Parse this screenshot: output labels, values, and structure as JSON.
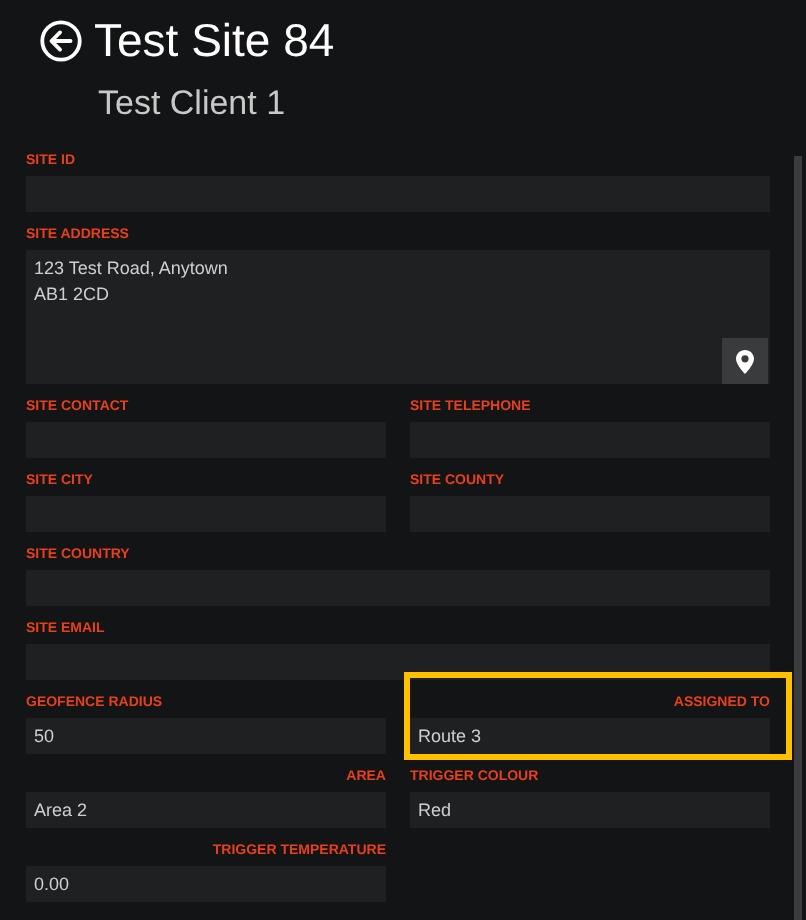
{
  "header": {
    "title": "Test Site 84",
    "subtitle": "Test Client 1"
  },
  "rows": [
    [
      {
        "kind": "text",
        "label": "SITE ID",
        "full_width": true,
        "label_right": false,
        "highlighted": false
      }
    ],
    [
      {
        "kind": "address",
        "label": "SITE ADDRESS",
        "value": "123 Test Road, Anytown\nAB1 2CD",
        "full_width": true,
        "label_right": false,
        "highlighted": false
      }
    ],
    [
      {
        "kind": "text",
        "label": "SITE CONTACT",
        "full_width": false,
        "label_right": false,
        "highlighted": false
      },
      {
        "kind": "text",
        "label": "SITE TELEPHONE",
        "full_width": false,
        "label_right": false,
        "highlighted": false
      }
    ],
    [
      {
        "kind": "text",
        "label": "SITE CITY",
        "full_width": false,
        "label_right": false,
        "highlighted": false
      },
      {
        "kind": "text",
        "label": "SITE COUNTY",
        "full_width": false,
        "label_right": false,
        "highlighted": false
      }
    ],
    [
      {
        "kind": "text",
        "label": "SITE COUNTRY",
        "full_width": true,
        "label_right": false,
        "highlighted": false
      }
    ],
    [
      {
        "kind": "text",
        "label": "SITE EMAIL",
        "full_width": true,
        "label_right": false,
        "highlighted": false
      }
    ],
    [
      {
        "kind": "text",
        "label": "GEOFENCE RADIUS",
        "value": "50",
        "full_width": false,
        "label_right": false,
        "highlighted": false
      },
      {
        "kind": "text",
        "label": "ASSIGNED TO",
        "value": "Route 3",
        "full_width": false,
        "label_right": true,
        "highlighted": true
      }
    ],
    [
      {
        "kind": "text",
        "label": "AREA",
        "value": "Area 2",
        "full_width": false,
        "label_right": true,
        "highlighted": false
      },
      {
        "kind": "text",
        "label": "TRIGGER COLOUR",
        "value": "Red",
        "full_width": false,
        "label_right": false,
        "highlighted": false
      }
    ],
    [
      {
        "kind": "text",
        "label": "TRIGGER TEMPERATURE",
        "value": "0.00",
        "full_width": false,
        "label_right": true,
        "highlighted": false
      }
    ]
  ]
}
